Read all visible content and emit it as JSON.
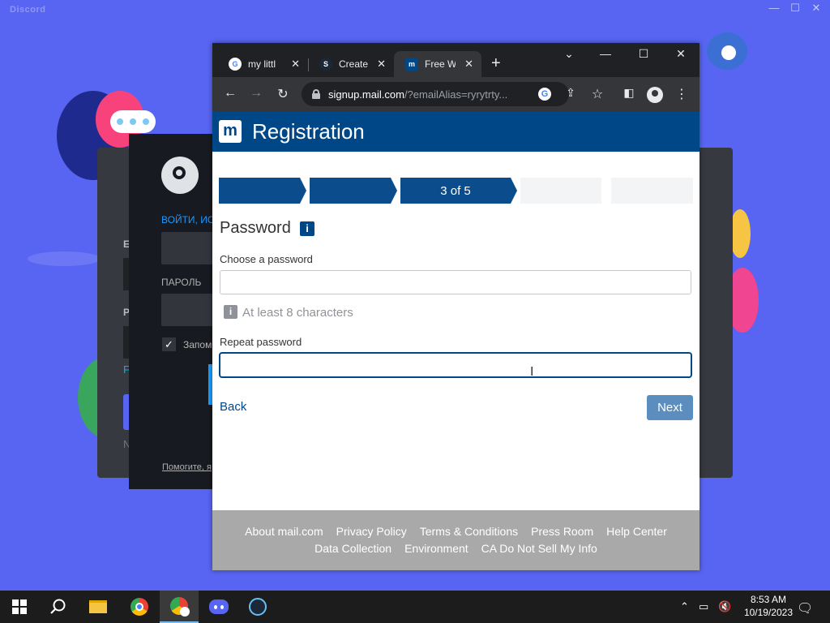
{
  "discord": {
    "title": "Discord",
    "controls": [
      "—",
      "☐",
      "✕"
    ],
    "side_label_1": "E",
    "side_label_2": "P",
    "side_link": "F",
    "side_text": "N"
  },
  "steam": {
    "signin_label": "ВОЙТИ, ИС",
    "password_label": "ПАРОЛЬ",
    "remember_label": "Запом",
    "help_link": "Помогите, я"
  },
  "browser": {
    "tabs": [
      {
        "title": "my littl",
        "icon": "google-icon",
        "active": false
      },
      {
        "title": "Create",
        "icon": "steam-icon",
        "active": false
      },
      {
        "title": "Free W",
        "icon": "mail-icon",
        "active": true
      }
    ],
    "new_tab": "+",
    "window_controls": {
      "dropdown": "⌄",
      "minimize": "—",
      "maximize": "☐",
      "close": "✕"
    },
    "url_host": "signup.mail.com",
    "url_rest": "/?emailAlias=ryrytrty...",
    "colors": {
      "chrome_dark": "#202124",
      "toolbar": "#35363a"
    }
  },
  "page": {
    "brand_letter": "m",
    "header_title": "Registration",
    "step_indicator": "3 of 5",
    "section_title": "Password",
    "info_badge": "i",
    "choose_label": "Choose a password",
    "choose_value": "",
    "hint_icon": "i",
    "hint": "At least 8 characters",
    "repeat_label": "Repeat password",
    "repeat_value": "",
    "back_label": "Back",
    "next_label": "Next",
    "colors": {
      "brand": "#004788",
      "next_button": "#5b8dbf",
      "footer": "#a9a9a9"
    }
  },
  "footer": {
    "row1": [
      "About mail.com",
      "Privacy Policy",
      "Terms & Conditions",
      "Press Room",
      "Help Center"
    ],
    "row2": [
      "Data Collection",
      "Environment",
      "CA Do Not Sell My Info"
    ]
  },
  "taskbar": {
    "apps": [
      "windows-start",
      "search",
      "file-explorer",
      "chrome",
      "chrome-profile",
      "discord",
      "steam"
    ],
    "time": "8:53 AM",
    "date": "10/19/2023"
  }
}
